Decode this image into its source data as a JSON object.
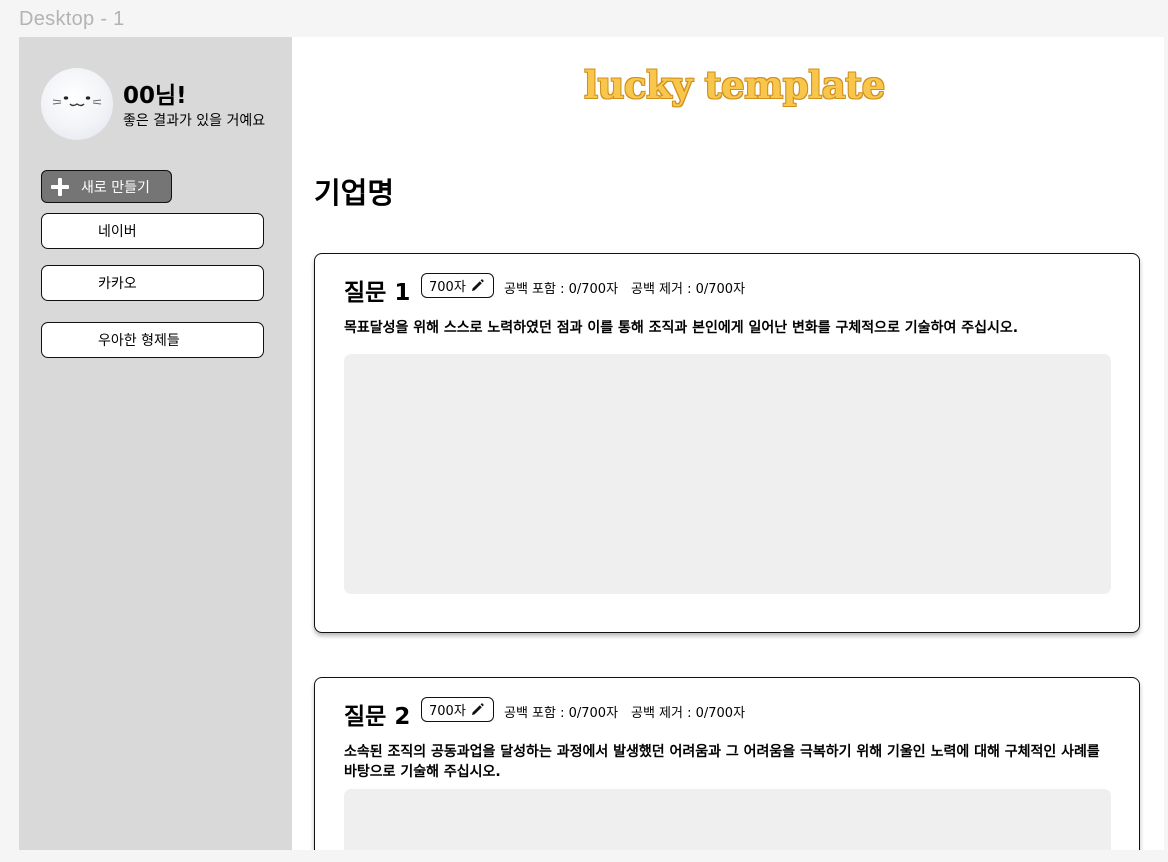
{
  "frame_title": "Desktop - 1",
  "sidebar": {
    "greeting_name": "00님!",
    "greeting_sub": "좋은 결과가 있을 거예요",
    "new_button_label": "새로 만들기",
    "companies": [
      "네이버",
      "카카오",
      "우아한 형제들"
    ]
  },
  "brand": {
    "logo_text": "lucky template",
    "logo_color": "#f7c64b"
  },
  "main": {
    "title": "기업명",
    "questions": [
      {
        "label": "질문 1",
        "limit": "700자",
        "count_with_spaces": "공백 포함 : 0/700자",
        "count_without_spaces": "공백 제거 : 0/700자",
        "text": "목표달성을 위해 스스로 노력하였던 점과 이를 통해 조직과 본인에게 일어난 변화를 구체적으로 기술하여 주십시오.",
        "answer": ""
      },
      {
        "label": "질문 2",
        "limit": "700자",
        "count_with_spaces": "공백 포함 : 0/700자",
        "count_without_spaces": "공백 제거 : 0/700자",
        "text": "소속된 조직의 공동과업을 달성하는 과정에서 발생했던 어려움과 그 어려움을 극복하기 위해 기울인 노력에 대해 구체적인 사례를 바탕으로 기술해 주십시오.",
        "answer": ""
      }
    ]
  },
  "icons": {
    "new": "plus-icon",
    "edit": "pencil-icon",
    "avatar": "cat-avatar"
  }
}
